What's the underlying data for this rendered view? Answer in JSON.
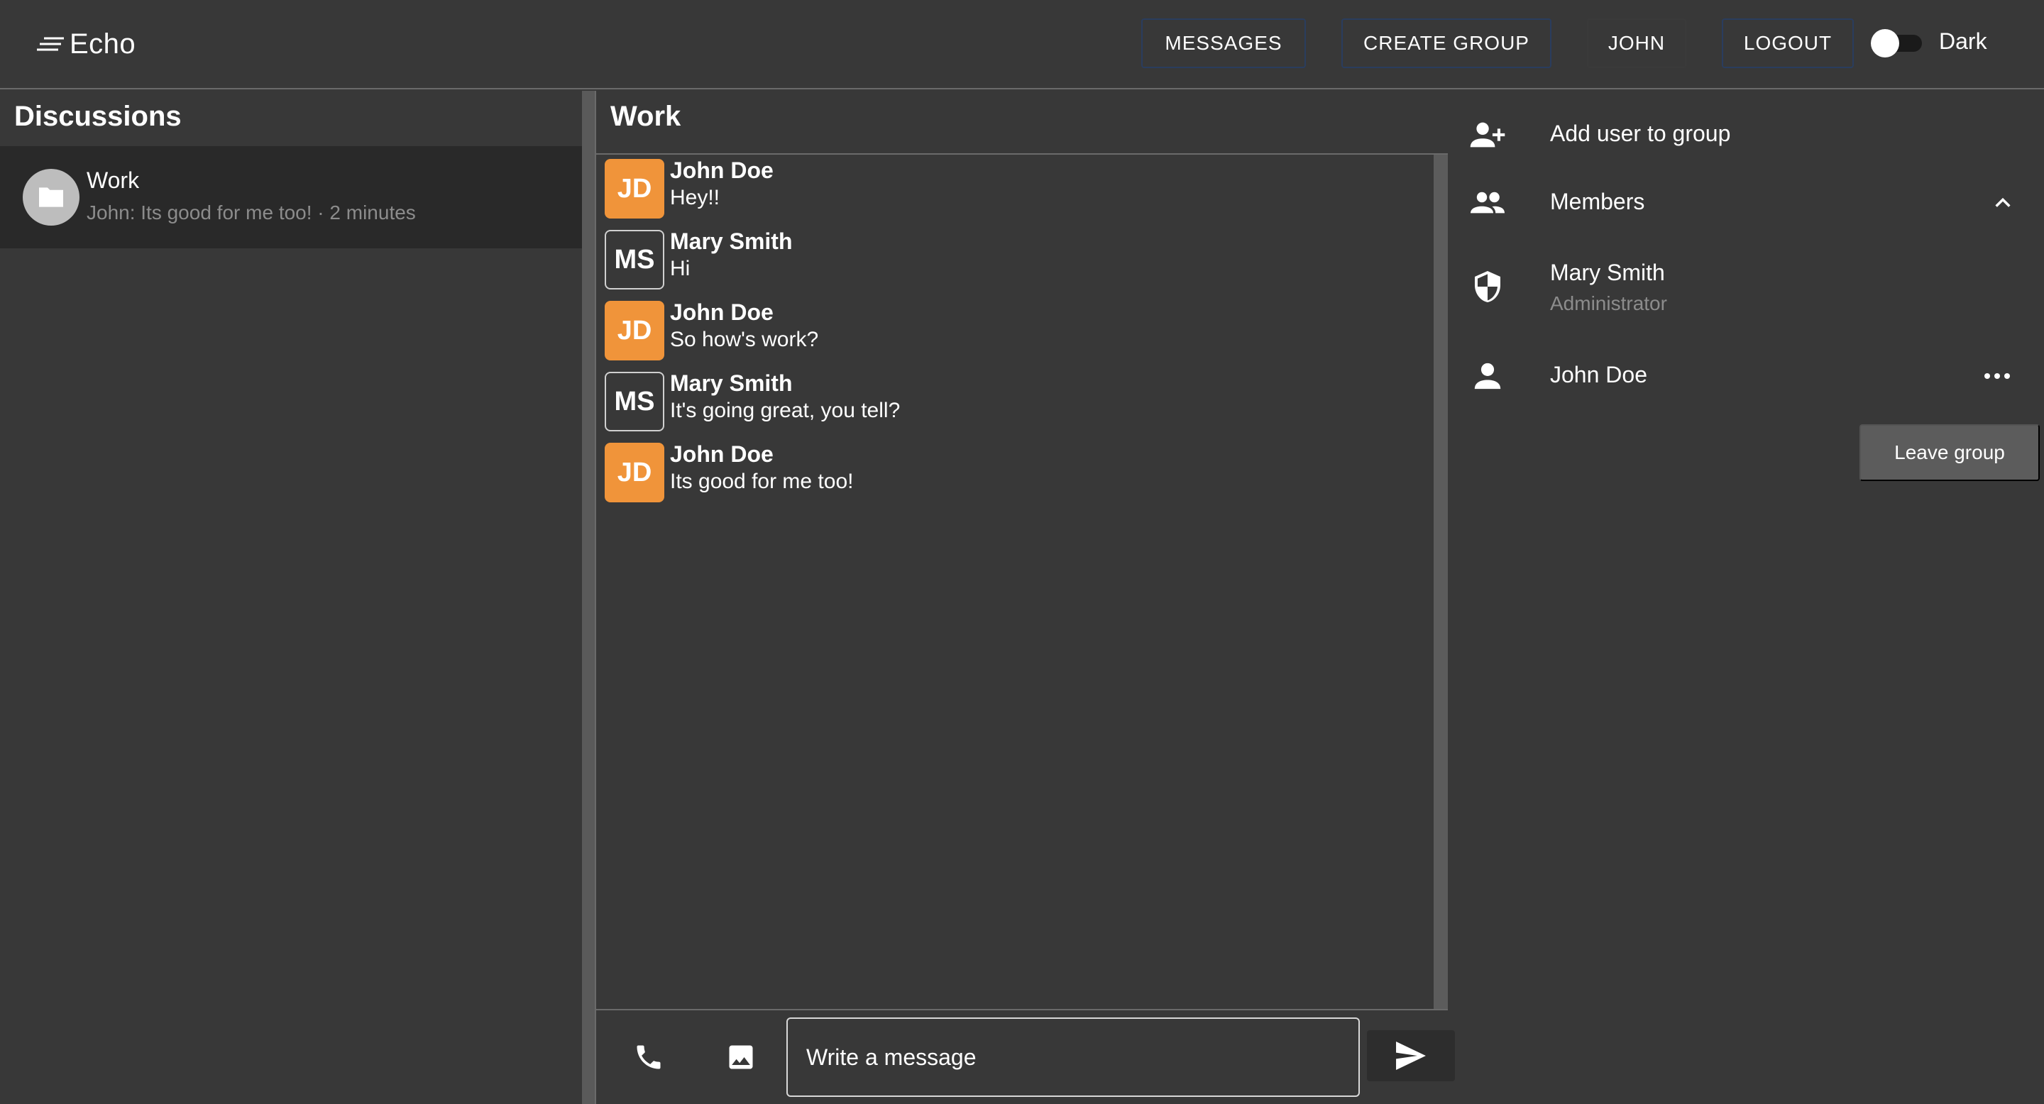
{
  "header": {
    "brand": "Echo",
    "nav": {
      "messages": "MESSAGES",
      "create_group": "CREATE GROUP",
      "user": "JOHN",
      "logout": "LOGOUT"
    },
    "theme_toggle_label": "Dark"
  },
  "sidebar": {
    "title": "Discussions",
    "discussions": [
      {
        "name": "Work",
        "preview": "John: Its good for me too! · 2 minutes",
        "icon": "folder-icon"
      }
    ]
  },
  "chat": {
    "title": "Work",
    "messages": [
      {
        "initials": "JD",
        "author": "John Doe",
        "text": "Hey!!"
      },
      {
        "initials": "MS",
        "author": "Mary Smith",
        "text": "Hi"
      },
      {
        "initials": "JD",
        "author": "John Doe",
        "text": "So how's work?"
      },
      {
        "initials": "MS",
        "author": "Mary Smith",
        "text": "It's going great, you tell?"
      },
      {
        "initials": "JD",
        "author": "John Doe",
        "text": "Its good for me too!"
      }
    ],
    "composer": {
      "placeholder": "Write a message"
    }
  },
  "group_panel": {
    "add_user": "Add user to group",
    "members_label": "Members",
    "members": [
      {
        "name": "Mary Smith",
        "role": "Administrator",
        "icon": "shield-icon"
      },
      {
        "name": "John Doe",
        "role": "",
        "icon": "person-icon"
      }
    ],
    "leave_group": "Leave group"
  },
  "colors": {
    "background": "#383838",
    "selected_row": "#292929",
    "avatar_john": "#f0943a",
    "nav_border": "#2a3d5e",
    "leave_button": "#5c5c5c"
  }
}
